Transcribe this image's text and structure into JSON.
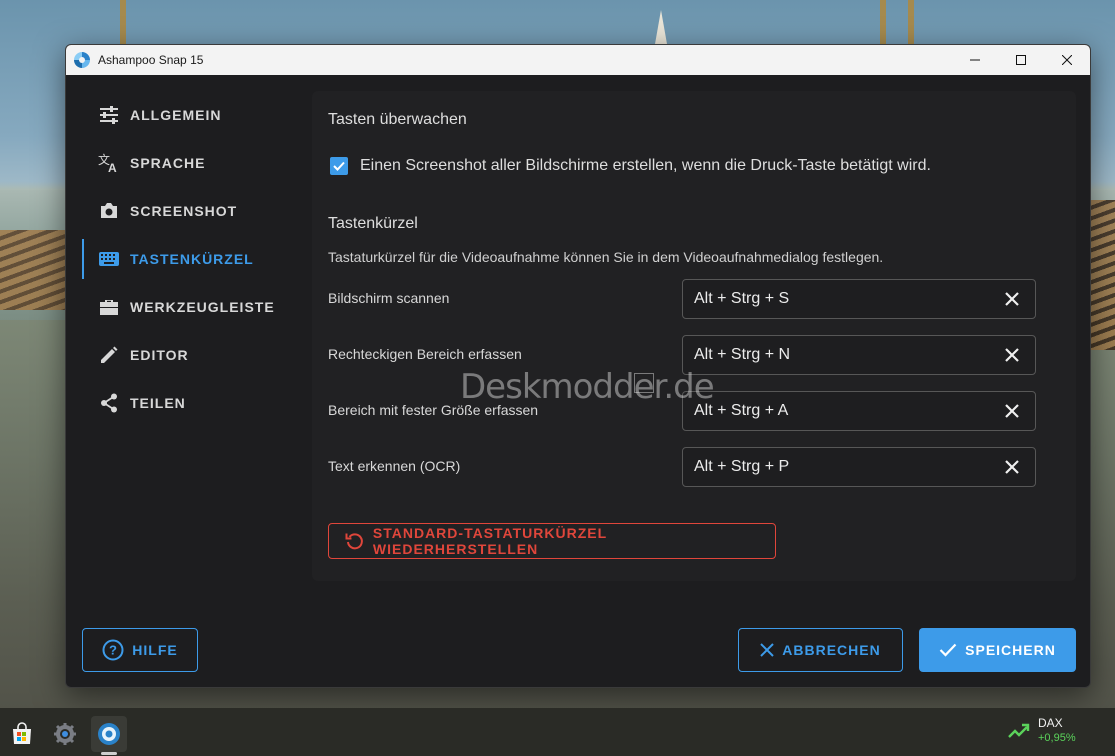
{
  "window": {
    "title": "Ashampoo Snap 15"
  },
  "sidebar": {
    "items": [
      {
        "label": "ALLGEMEIN",
        "icon": "sliders-icon"
      },
      {
        "label": "SPRACHE",
        "icon": "translate-icon"
      },
      {
        "label": "SCREENSHOT",
        "icon": "camera-icon"
      },
      {
        "label": "TASTENKÜRZEL",
        "icon": "keyboard-icon",
        "active": true
      },
      {
        "label": "WERKZEUGLEISTE",
        "icon": "toolbox-icon"
      },
      {
        "label": "EDITOR",
        "icon": "pencil-icon"
      },
      {
        "label": "TEILEN",
        "icon": "share-icon"
      }
    ]
  },
  "main": {
    "section1_title": "Tasten überwachen",
    "checkbox_label": "Einen Screenshot aller Bildschirme erstellen, wenn die Druck-Taste betätigt wird.",
    "checkbox_checked": true,
    "section2_title": "Tastenkürzel",
    "description": "Tastaturkürzel für die Videoaufnahme können Sie in dem Videoaufnahmedialog festlegen.",
    "shortcuts": [
      {
        "label": "Bildschirm scannen",
        "value": "Alt + Strg + S"
      },
      {
        "label": "Rechteckigen Bereich erfassen",
        "value": "Alt + Strg + N"
      },
      {
        "label": "Bereich mit fester Größe erfassen",
        "value": "Alt + Strg + A"
      },
      {
        "label": "Text erkennen (OCR)",
        "value": "Alt + Strg + P"
      }
    ],
    "reset_label": "STANDARD-TASTATURKÜRZEL WIEDERHERSTELLEN",
    "watermark": "Deskmodder.de"
  },
  "footer": {
    "help_label": "HILFE",
    "cancel_label": "ABBRECHEN",
    "save_label": "SPEICHERN"
  },
  "taskbar": {
    "ticker_name": "DAX",
    "ticker_value": "+0,95%"
  },
  "colors": {
    "accent": "#3d9be9",
    "danger": "#e0463b",
    "background": "#1d1d1f",
    "panel": "#212123",
    "ticker_up": "#5bd35b"
  }
}
